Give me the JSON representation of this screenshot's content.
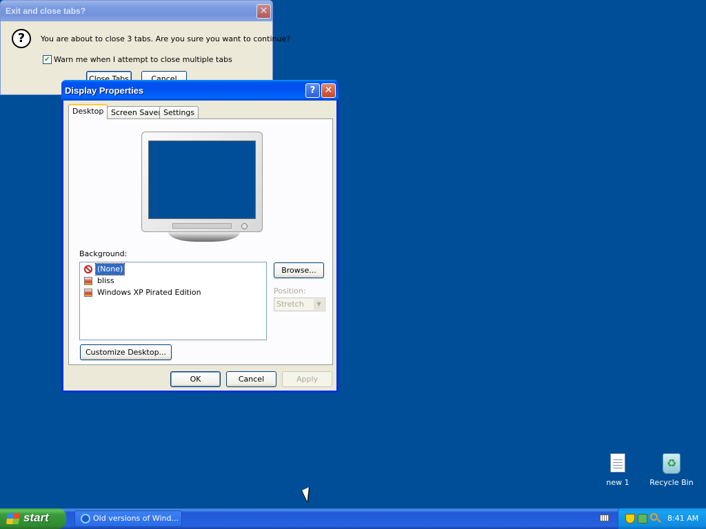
{
  "exit_dialog": {
    "title": "Exit and close tabs?",
    "close_glyph": "✕",
    "icon": "question-icon",
    "icon_glyph": "?",
    "message": "You are about to close 3 tabs. Are you sure you want to continue?",
    "checkbox_label": "Warn me when I attempt to close multiple tabs",
    "checkbox_checked": true,
    "checkbox_glyph": "✔",
    "close_tabs_label": "Close Tabs",
    "cancel_label": "Cancel"
  },
  "display_properties": {
    "title": "Display Properties",
    "help_glyph": "?",
    "close_glyph": "✕",
    "tabs": [
      {
        "label": "Desktop",
        "active": true
      },
      {
        "label": "Screen Saver",
        "active": false
      },
      {
        "label": "Settings",
        "active": false
      }
    ],
    "preview_screen_color": "#004e98",
    "background_label": "Background:",
    "background_items": [
      {
        "label": "(None)",
        "icon": "none-icon",
        "selected": true
      },
      {
        "label": "bliss",
        "icon": "image-icon",
        "selected": false
      },
      {
        "label": "Windows XP Pirated Edition",
        "icon": "image-icon",
        "selected": false
      }
    ],
    "browse_label": "Browse...",
    "position_label": "Position:",
    "position_value": "Stretch",
    "position_arrow": "▼",
    "customize_label": "Customize Desktop...",
    "ok_label": "OK",
    "cancel_label": "Cancel",
    "apply_label": "Apply"
  },
  "desktop_icons": [
    {
      "label": "new 1",
      "icon": "notepad-icon"
    },
    {
      "label": "Recycle Bin",
      "icon": "recycle-bin-icon",
      "glyph": "♻"
    }
  ],
  "taskbar": {
    "start_label": "start",
    "task_label": "Old versions of Wind...",
    "clock": "8:41 AM"
  },
  "colors": {
    "desktop": "#004e98",
    "title_active": "#0054e3",
    "title_inactive": "#7b9ce0",
    "start_green": "#3c9a3c"
  }
}
